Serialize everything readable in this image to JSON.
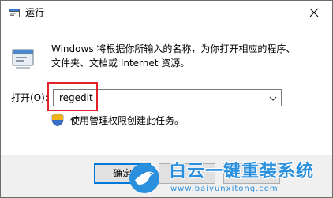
{
  "window": {
    "title": "运行",
    "icon": "run-app-icon",
    "close_icon": "close-icon"
  },
  "description": {
    "line1": "Windows 将根据你所输入的名称，为你打开相应的程序、",
    "line2": "文件夹、文档或 Internet 资源。"
  },
  "open": {
    "label": "打开(O):",
    "value": "regedit",
    "dropdown_icon": "chevron-down-icon",
    "highlight_color": "#e0222b"
  },
  "admin_notice": {
    "icon": "uac-shield-icon",
    "text": "使用管理权限创建此任务。"
  },
  "buttons": {
    "ok_label": "确定",
    "cancel_label": "",
    "browse_label": ""
  },
  "watermark": {
    "title": "白云一键重装系统",
    "url": "www.baiyunxitong.com",
    "color": "#2a8fdc"
  }
}
